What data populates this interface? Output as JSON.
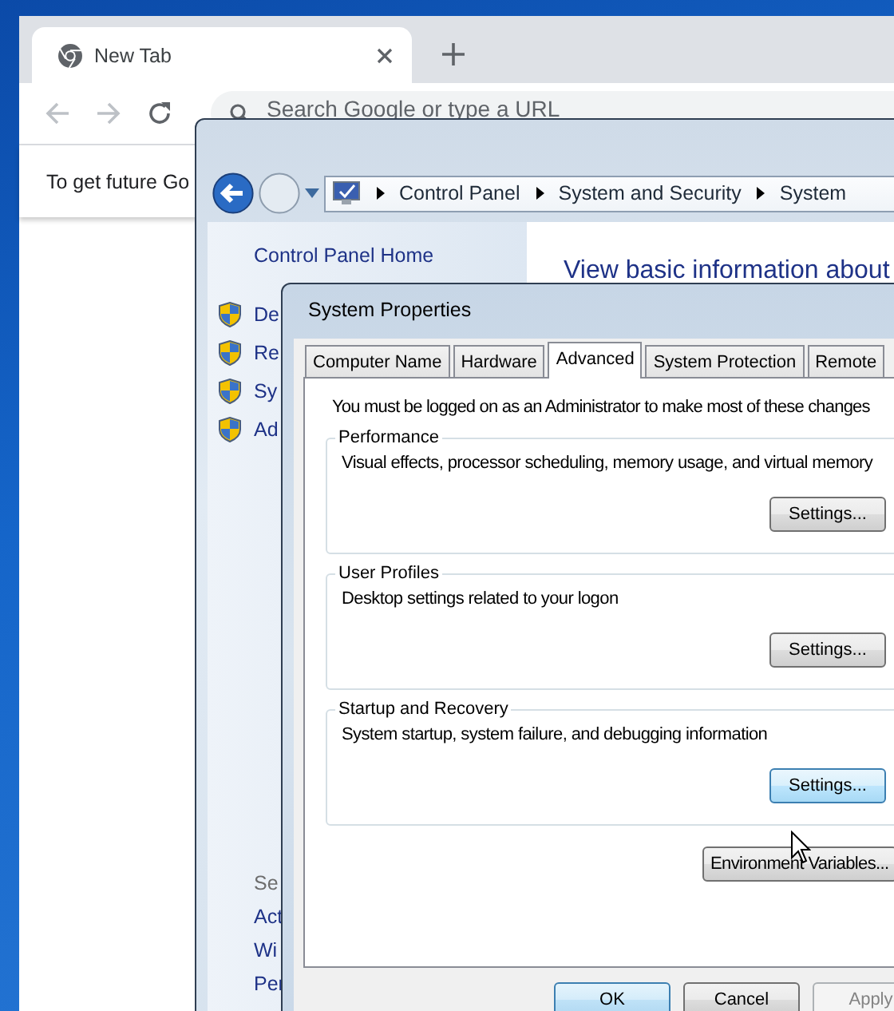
{
  "browser": {
    "tabs": [
      {
        "title": "New Tab",
        "selected": true
      }
    ],
    "omnibox": {
      "placeholder": "Search Google or type a URL"
    },
    "infobar": "To get future Go"
  },
  "control_panel": {
    "breadcrumb": [
      "Control Panel",
      "System and Security",
      "System"
    ],
    "sidebar": {
      "home": "Control Panel Home",
      "tasks": [
        "De",
        "Re",
        "Sy",
        "Ad"
      ],
      "see_also": "Se",
      "links": [
        "Act",
        "Wi",
        "Per"
      ]
    },
    "heading": "View basic information about"
  },
  "dialog": {
    "title": "System Properties",
    "tabs": [
      {
        "label": "Computer Name",
        "selected": false
      },
      {
        "label": "Hardware",
        "selected": false
      },
      {
        "label": "Advanced",
        "selected": true
      },
      {
        "label": "System Protection",
        "selected": false
      },
      {
        "label": "Remote",
        "selected": false
      }
    ],
    "notice": "You must be logged on as an Administrator to make most of these changes",
    "groups": [
      {
        "title": "Performance",
        "description": "Visual effects, processor scheduling, memory usage, and virtual memory",
        "button": {
          "label": "Settings...",
          "hovered": false
        }
      },
      {
        "title": "User Profiles",
        "description": "Desktop settings related to your logon",
        "button": {
          "label": "Settings...",
          "hovered": false
        }
      },
      {
        "title": "Startup and Recovery",
        "description": "System startup, system failure, and debugging information",
        "button": {
          "label": "Settings...",
          "hovered": true
        }
      }
    ],
    "environment_button": "Environment Variables...",
    "buttons": [
      {
        "label": "OK",
        "kind": "default"
      },
      {
        "label": "Cancel",
        "kind": "normal"
      },
      {
        "label": "Apply",
        "kind": "disabled"
      }
    ]
  }
}
